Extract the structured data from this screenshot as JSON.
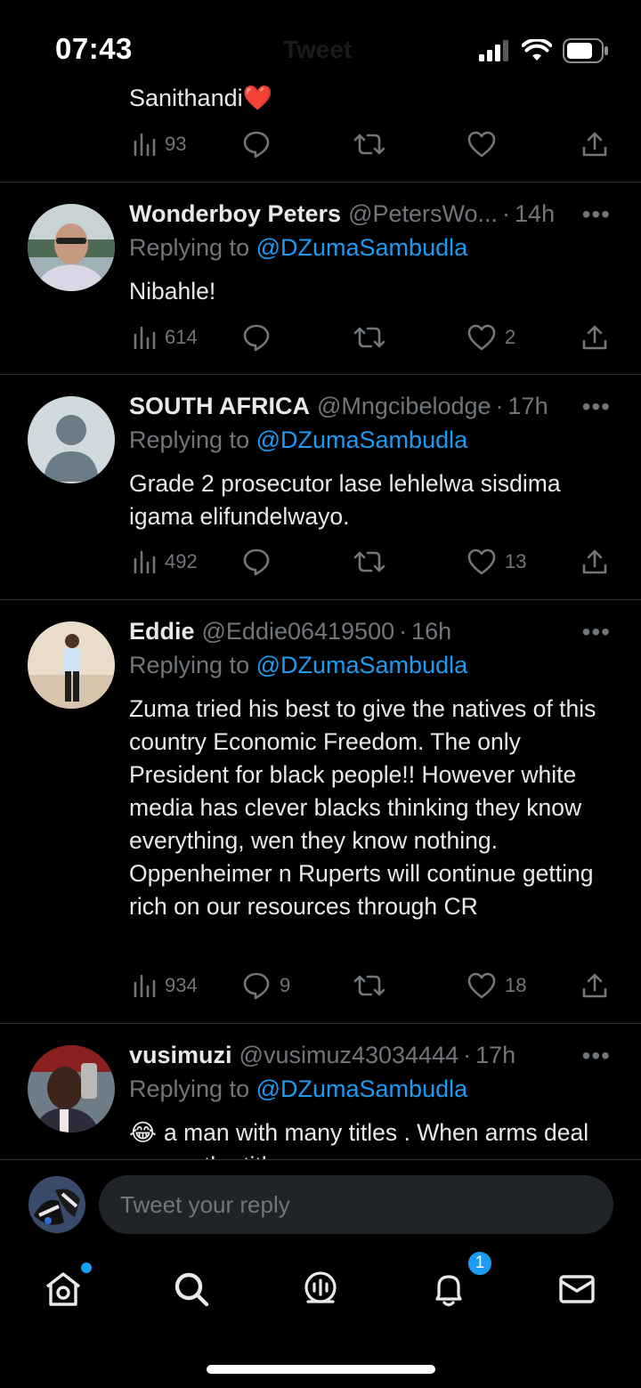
{
  "status_bar": {
    "time": "07:43",
    "ghost_title": "Tweet"
  },
  "tweets": [
    {
      "text": "Sanithandi",
      "emoji": "❤️",
      "views": "93",
      "replies": "",
      "retweets": "",
      "likes": ""
    },
    {
      "name": "Wonderboy Peters",
      "handle": "@PetersWo...",
      "time": "14h",
      "replying_prefix": "Replying to",
      "replying_to": "@DZumaSambudla",
      "text": "Nibahle!",
      "views": "614",
      "replies": "",
      "retweets": "",
      "likes": "2"
    },
    {
      "name": "SOUTH AFRICA",
      "handle": "@Mngcibelodge",
      "time": "17h",
      "replying_prefix": "Replying to",
      "replying_to": "@DZumaSambudla",
      "text": "Grade 2 prosecutor lase lehlelwa sisdima igama elifundelwayo.",
      "views": "492",
      "replies": "",
      "retweets": "",
      "likes": "13"
    },
    {
      "name": "Eddie",
      "handle": "@Eddie06419500",
      "time": "16h",
      "replying_prefix": "Replying to",
      "replying_to": "@DZumaSambudla",
      "text": "Zuma tried his best to give the natives of this country Economic Freedom. The only President for black people!! However white media has clever blacks thinking they know everything, wen they know nothing. Oppenheimer n Ruperts will continue getting rich on our resources through CR",
      "views": "934",
      "replies": "9",
      "retweets": "",
      "likes": "18"
    },
    {
      "name": "vusimuzi",
      "handle": "@vusimuz43034444",
      "time": "17h",
      "replying_prefix": "Replying to",
      "replying_to": "@DZumaSambudla",
      "emoji": "😂",
      "text": "a man with many titles . When arms deal was  ...  the titles ..."
    }
  ],
  "reply_bar": {
    "placeholder": "Tweet your reply"
  },
  "tab_bar": {
    "notifications_count": "1"
  },
  "colors": {
    "background": "#000000",
    "accent": "#1d9bf0",
    "muted": "#71767b",
    "text": "#e7e9ea",
    "divider": "#2f3336",
    "like_heart": "#f91880"
  }
}
